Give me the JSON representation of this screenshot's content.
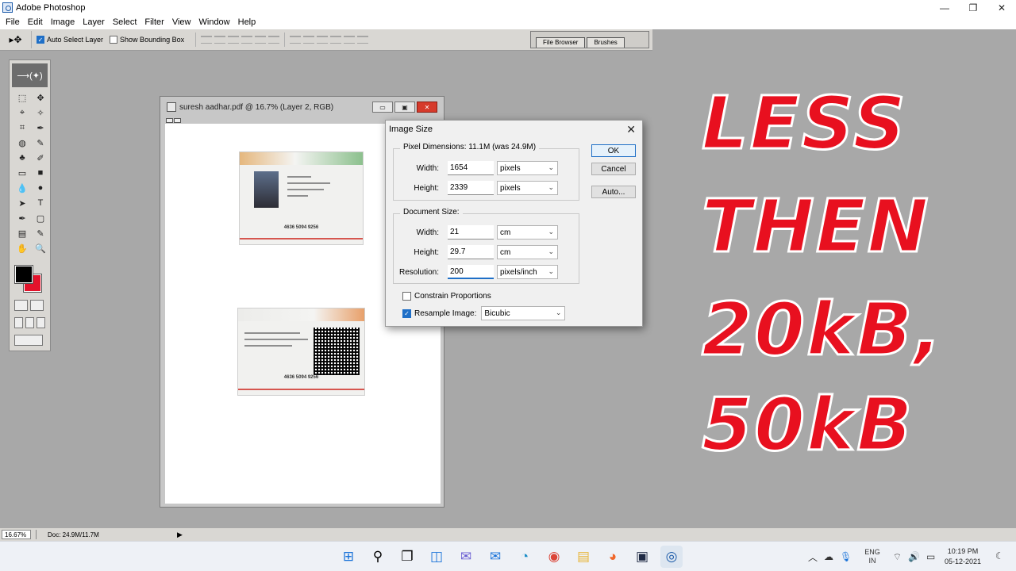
{
  "window": {
    "title": "Adobe Photoshop",
    "controls": [
      "—",
      "❐",
      "✕"
    ]
  },
  "menu": [
    "File",
    "Edit",
    "Image",
    "Layer",
    "Select",
    "Filter",
    "View",
    "Window",
    "Help"
  ],
  "options_bar": {
    "tool_glyph": "▸✥",
    "auto_select_layer": {
      "label": "Auto Select Layer",
      "checked": true
    },
    "show_bounding_box": {
      "label": "Show Bounding Box",
      "checked": false
    },
    "palette_tabs": [
      "File Browser",
      "Brushes"
    ]
  },
  "toolbox": {
    "header_glyph": "⟶(✦)",
    "tools": [
      "⬚",
      "✥",
      "⌖",
      "✧",
      "⌗",
      "✒",
      "◍",
      "✎",
      "♣",
      "✐",
      "▭",
      "■",
      "💧",
      "●",
      "➤",
      "T",
      "✒",
      "▢",
      "▤",
      "✎",
      "✋",
      "🔍"
    ],
    "foreground_color": "#000000",
    "background_color": "#e3132b"
  },
  "document": {
    "title": "suresh aadhar.pdf @ 16.7% (Layer 2, RGB)",
    "controls": [
      "▭",
      "▣",
      "✕"
    ],
    "card1_number": "4636 5094 9256",
    "card2_number": "4636 5094 9256"
  },
  "dialog": {
    "title": "Image Size",
    "close": "✕",
    "pixel_dimensions": {
      "label": "Pixel Dimensions:  11.1M (was 24.9M)",
      "width_label": "Width:",
      "width_value": "1654",
      "width_unit": "pixels",
      "height_label": "Height:",
      "height_value": "2339",
      "height_unit": "pixels"
    },
    "document_size": {
      "label": "Document Size:",
      "width_label": "Width:",
      "width_value": "21",
      "width_unit": "cm",
      "height_label": "Height:",
      "height_value": "29.7",
      "height_unit": "cm",
      "resolution_label": "Resolution:",
      "resolution_value": "200",
      "resolution_unit": "pixels/inch"
    },
    "constrain_proportions": {
      "label": "Constrain Proportions",
      "checked": false
    },
    "resample_image": {
      "label": "Resample Image:",
      "checked": true,
      "method": "Bicubic"
    },
    "buttons": {
      "ok": "OK",
      "cancel": "Cancel",
      "auto": "Auto..."
    }
  },
  "overlay_text": [
    "LESS",
    "THEN",
    "20kB,",
    "50kB"
  ],
  "status_bar": {
    "zoom": "16.67%",
    "doc": "Doc: 24.9M/11.7M",
    "arrow": "▶"
  },
  "taskbar": {
    "icons": [
      "start-icon",
      "search-icon",
      "task-view-icon",
      "widgets-icon",
      "chat-icon",
      "mail-icon",
      "edge-icon",
      "chrome-icon",
      "file-explorer-icon",
      "firefox-icon",
      "terminal-icon",
      "photoshop-icon"
    ],
    "icon_glyphs": [
      "⊞",
      "⚲",
      "❐",
      "◫",
      "✉",
      "✉",
      "◔",
      "◉",
      "▤",
      "◕",
      "▣",
      "◎"
    ],
    "lang_line1": "ENG",
    "lang_line2": "IN",
    "time": "10:19 PM",
    "date": "05-12-2021"
  }
}
